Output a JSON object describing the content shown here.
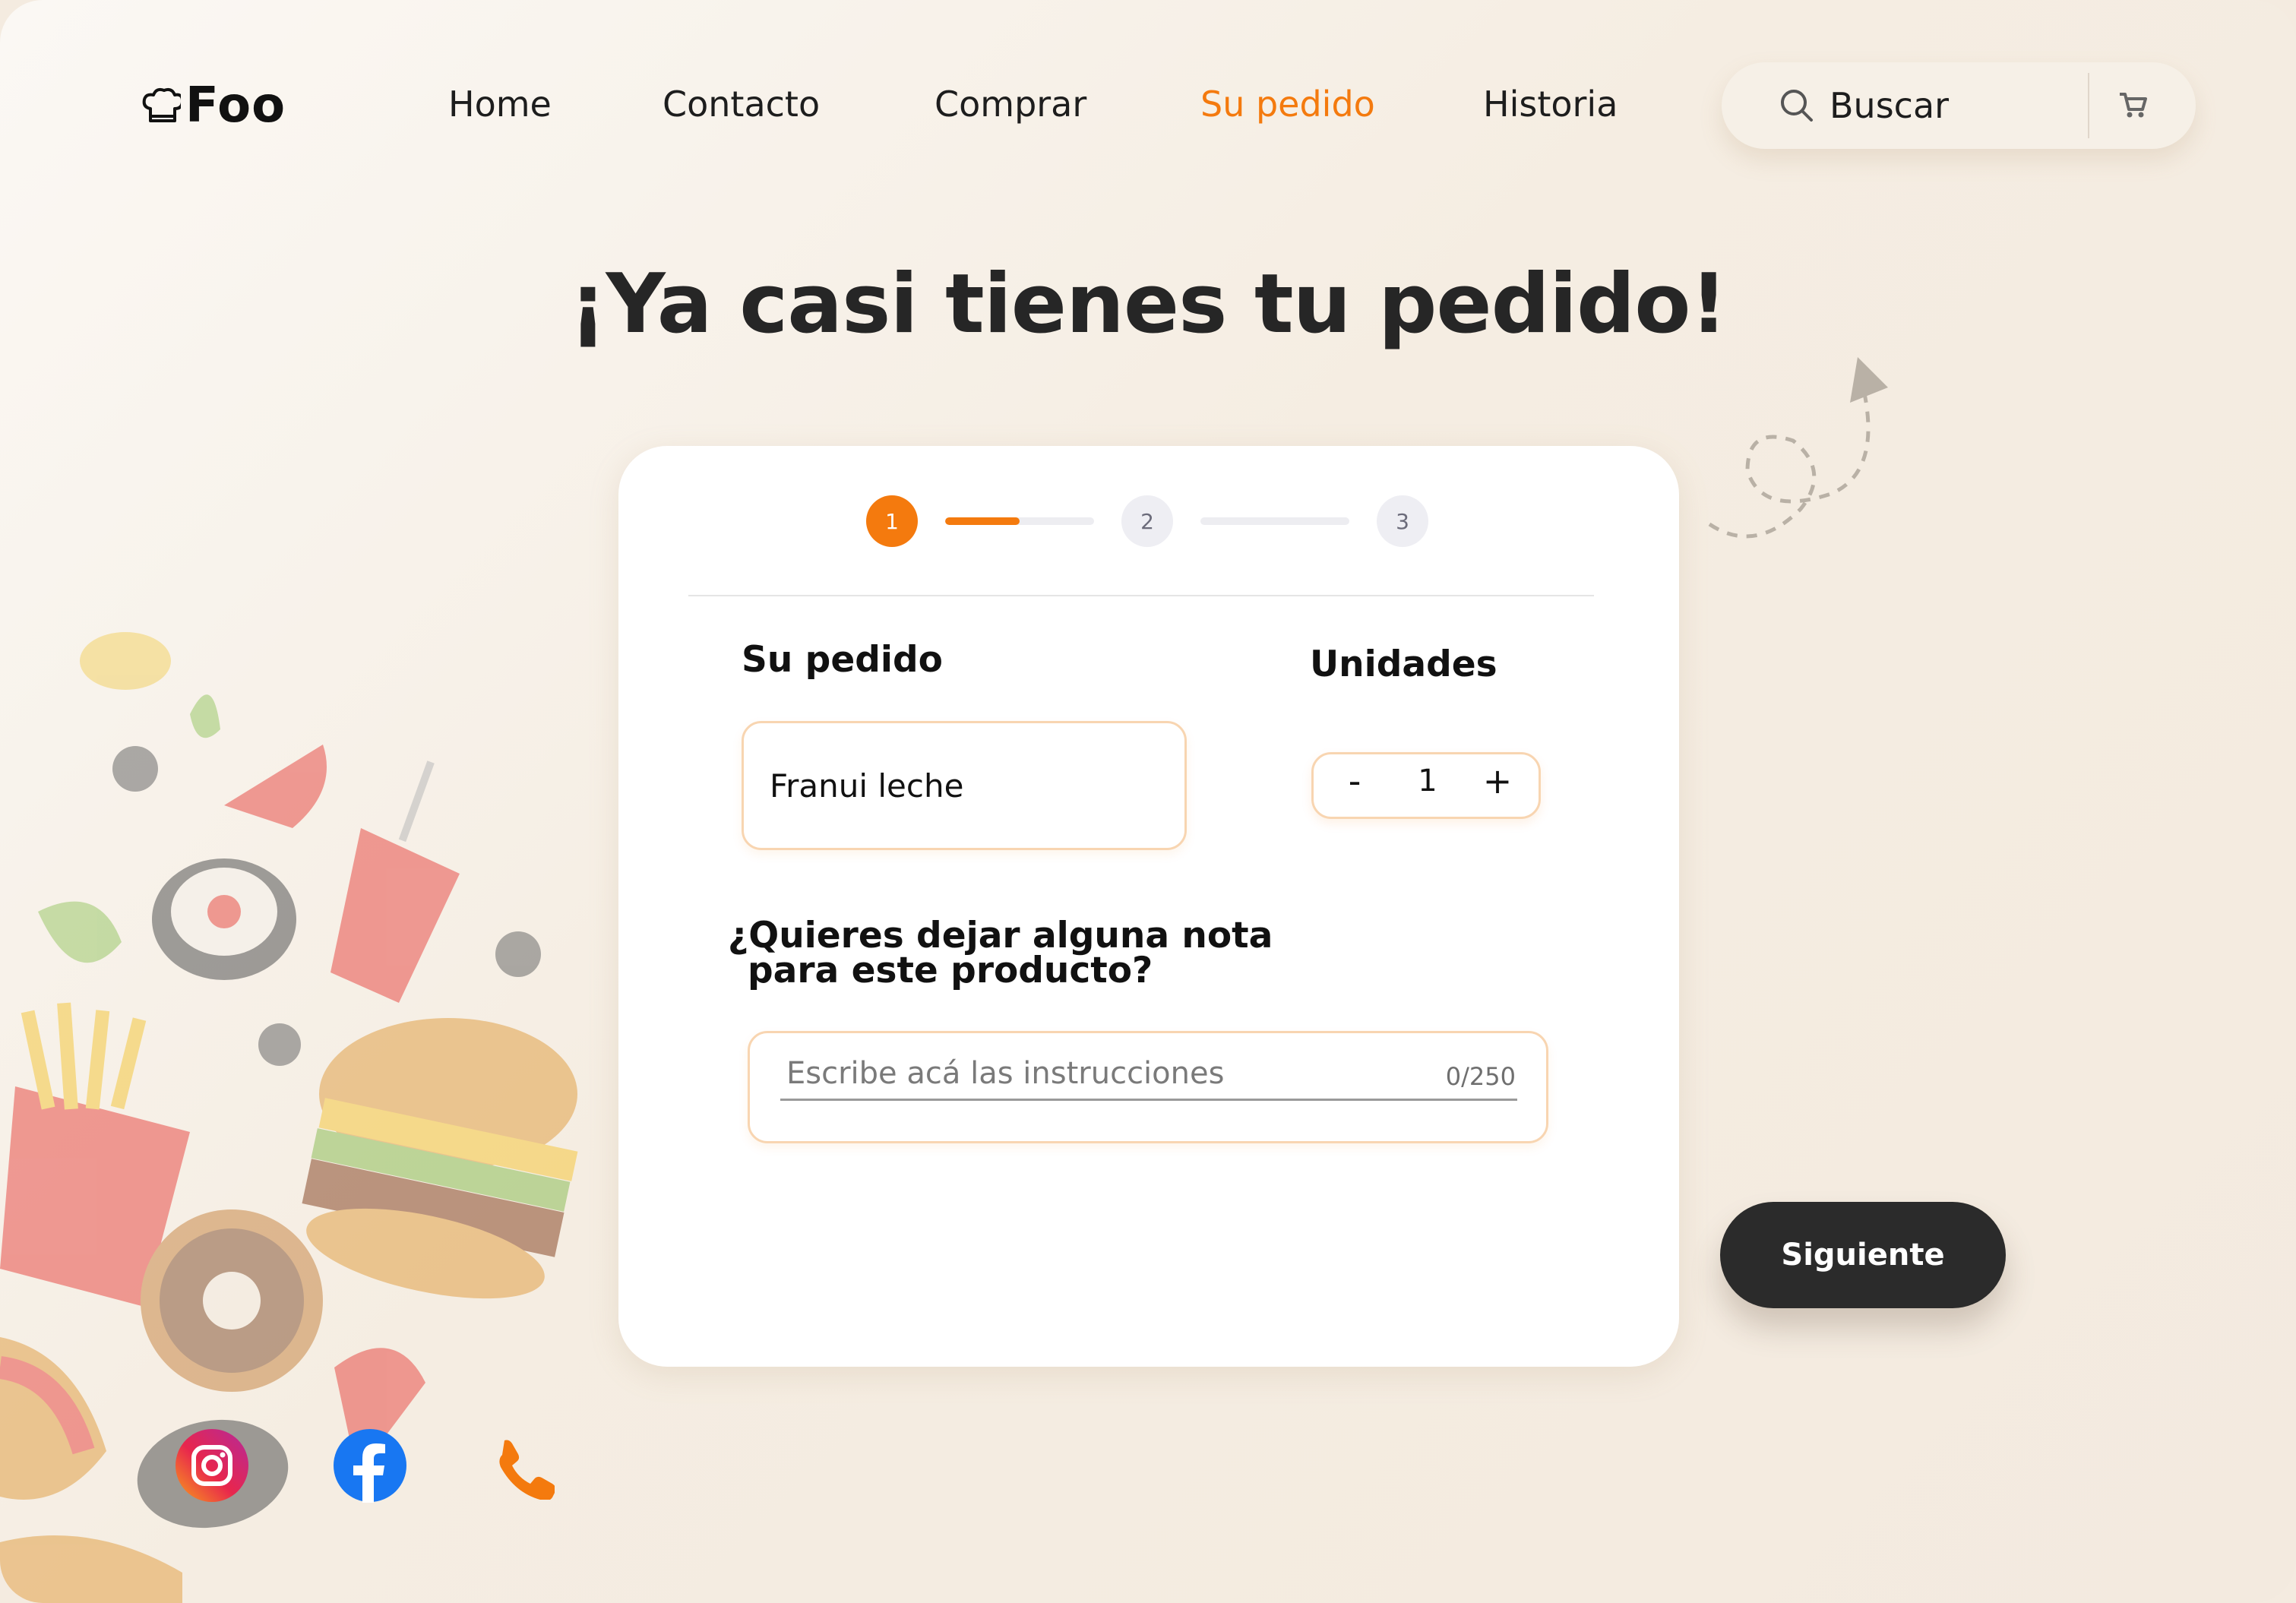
{
  "brand": {
    "name": "Foo",
    "logo_icon": "chef-hat-icon"
  },
  "nav": {
    "items": [
      {
        "label": "Home",
        "active": false
      },
      {
        "label": "Contacto",
        "active": false
      },
      {
        "label": "Comprar",
        "active": false
      },
      {
        "label": "Su pedido",
        "active": true
      },
      {
        "label": "Historia",
        "active": false
      }
    ]
  },
  "search": {
    "placeholder": "Buscar",
    "icon": "search-icon",
    "cart_icon": "cart-icon"
  },
  "page": {
    "title": "¡Ya casi tienes tu pedido!"
  },
  "stepper": {
    "steps": [
      "1",
      "2",
      "3"
    ],
    "current_step": 1,
    "bar1_progress": 0.5,
    "bar2_progress": 0
  },
  "order": {
    "product_label": "Su pedido",
    "product_value": "Franui leche",
    "units_label": "Unidades",
    "minus_label": "-",
    "plus_label": "+",
    "quantity": "1"
  },
  "note": {
    "question_line1": "¿Quieres dejar alguna nota",
    "question_line2": "para este producto?",
    "placeholder": "Escribe acá las instrucciones",
    "counter": "0/250"
  },
  "actions": {
    "next_label": "Siguiente"
  },
  "social": {
    "items": [
      {
        "name": "instagram-icon"
      },
      {
        "name": "facebook-icon"
      },
      {
        "name": "phone-icon"
      }
    ]
  },
  "colors": {
    "accent": "#f47a0e",
    "dark": "#2b2b2b",
    "background": "#f4ebe0",
    "field_border": "#f8d5b1"
  }
}
